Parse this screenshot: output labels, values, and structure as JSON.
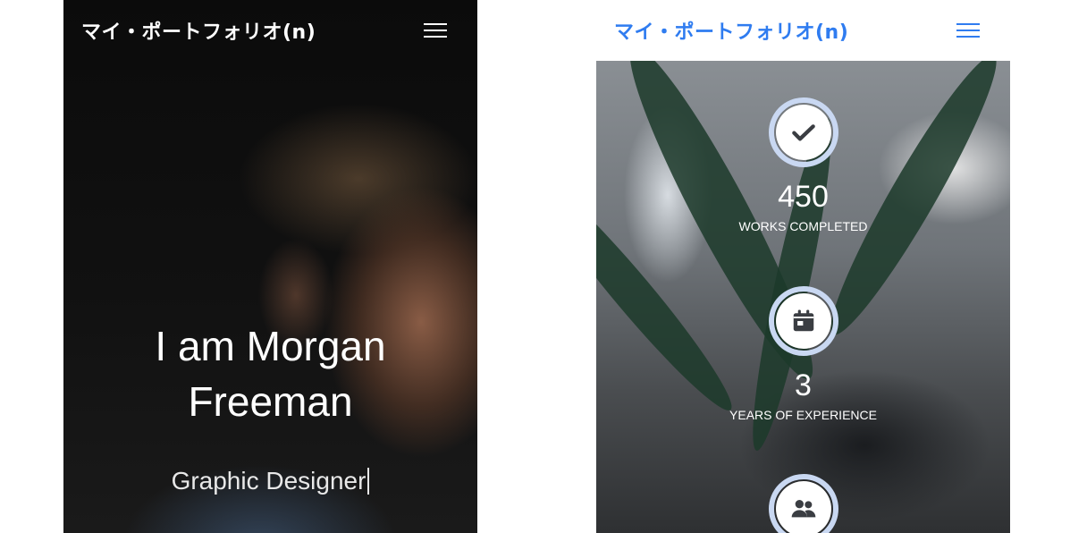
{
  "left_screen": {
    "nav": {
      "brand": "マイ・ポートフォリオ(n)",
      "menu_icon": "hamburger-icon"
    },
    "hero": {
      "title_line1": "I am Morgan",
      "title_line2": "Freeman",
      "subtitle": "Graphic Designer"
    }
  },
  "right_screen": {
    "nav": {
      "brand": "マイ・ポートフォリオ(n)",
      "menu_icon": "hamburger-icon"
    },
    "stats": [
      {
        "icon": "check-icon",
        "value": "450",
        "label": "WORKS COMPLETED"
      },
      {
        "icon": "calendar-icon",
        "value": "3",
        "label": "YEARS OF EXPERIENCE"
      },
      {
        "icon": "users-icon",
        "value": "",
        "label": ""
      }
    ]
  },
  "colors": {
    "brand_blue": "#2f7cf0",
    "circle_ring": "#c9d8f2",
    "dark_bg": "#0b0b0b"
  }
}
